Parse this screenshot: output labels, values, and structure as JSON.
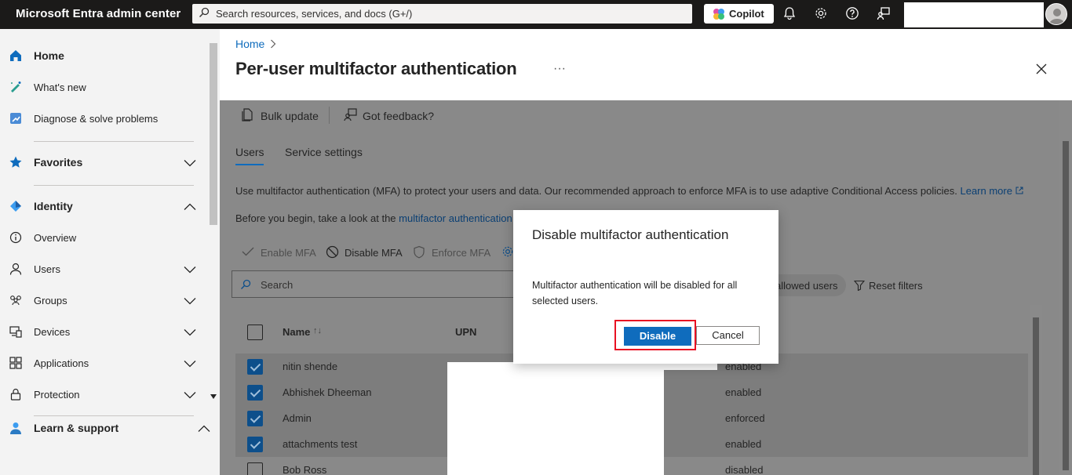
{
  "topbar": {
    "brand": "Microsoft Entra admin center",
    "search_placeholder": "Search resources, services, and docs (G+/)",
    "copilot_label": "Copilot",
    "icons": [
      "bell-icon",
      "gear-icon",
      "help-icon",
      "feedback-icon"
    ]
  },
  "sidebar": {
    "items": [
      {
        "label": "Home",
        "icon": "home-icon"
      },
      {
        "label": "What's new",
        "icon": "whats-new-icon"
      },
      {
        "label": "Diagnose & solve problems",
        "icon": "diagnose-icon"
      },
      {
        "label": "Favorites",
        "icon": "star-icon"
      },
      {
        "label": "Identity",
        "icon": "identity-icon"
      },
      {
        "label": "Overview",
        "icon": "info-icon"
      },
      {
        "label": "Users",
        "icon": "user-icon"
      },
      {
        "label": "Groups",
        "icon": "groups-icon"
      },
      {
        "label": "Devices",
        "icon": "devices-icon"
      },
      {
        "label": "Applications",
        "icon": "applications-icon"
      },
      {
        "label": "Protection",
        "icon": "lock-icon"
      },
      {
        "label": "Learn & support",
        "icon": "learn-icon"
      }
    ],
    "collapse_glyph": "«"
  },
  "breadcrumb": {
    "home": "Home"
  },
  "page": {
    "title": "Per-user multifactor authentication",
    "more": "···"
  },
  "toolbar": {
    "bulk_update": "Bulk update",
    "feedback": "Got feedback?"
  },
  "tabs": {
    "users": "Users",
    "service_settings": "Service settings"
  },
  "info": {
    "line1": "Use multifactor authentication (MFA) to protect your users and data. Our recommended approach to enforce MFA is to use adaptive Conditional Access policies.",
    "learn_more": "Learn more",
    "line2_prefix": "Before you begin, take a look at the",
    "line2_link": "multifactor authentication"
  },
  "actions": {
    "enable": "Enable MFA",
    "disable": "Disable MFA",
    "enforce": "Enforce MFA"
  },
  "grid": {
    "search_placeholder": "Search",
    "filter_pill": "allowed users",
    "reset_filters": "Reset filters",
    "columns": {
      "name": "Name",
      "sort_glyph": "↑↓",
      "upn": "UPN"
    },
    "rows": [
      {
        "name": "nitin shende",
        "status": "enabled",
        "selected": true
      },
      {
        "name": "Abhishek Dheeman",
        "status": "enabled",
        "selected": true
      },
      {
        "name": "Admin",
        "status": "enforced",
        "selected": true
      },
      {
        "name": "attachments test",
        "status": "enabled",
        "selected": true
      },
      {
        "name": "Bob Ross",
        "status": "disabled",
        "selected": false
      }
    ]
  },
  "dialog": {
    "title": "Disable multifactor authentication",
    "body": "Multifactor authentication will be disabled for all selected users.",
    "confirm": "Disable",
    "cancel": "Cancel"
  },
  "colors": {
    "accent": "#0f6cbd",
    "topbar": "#1b1a19",
    "highlight": "#e81123"
  }
}
